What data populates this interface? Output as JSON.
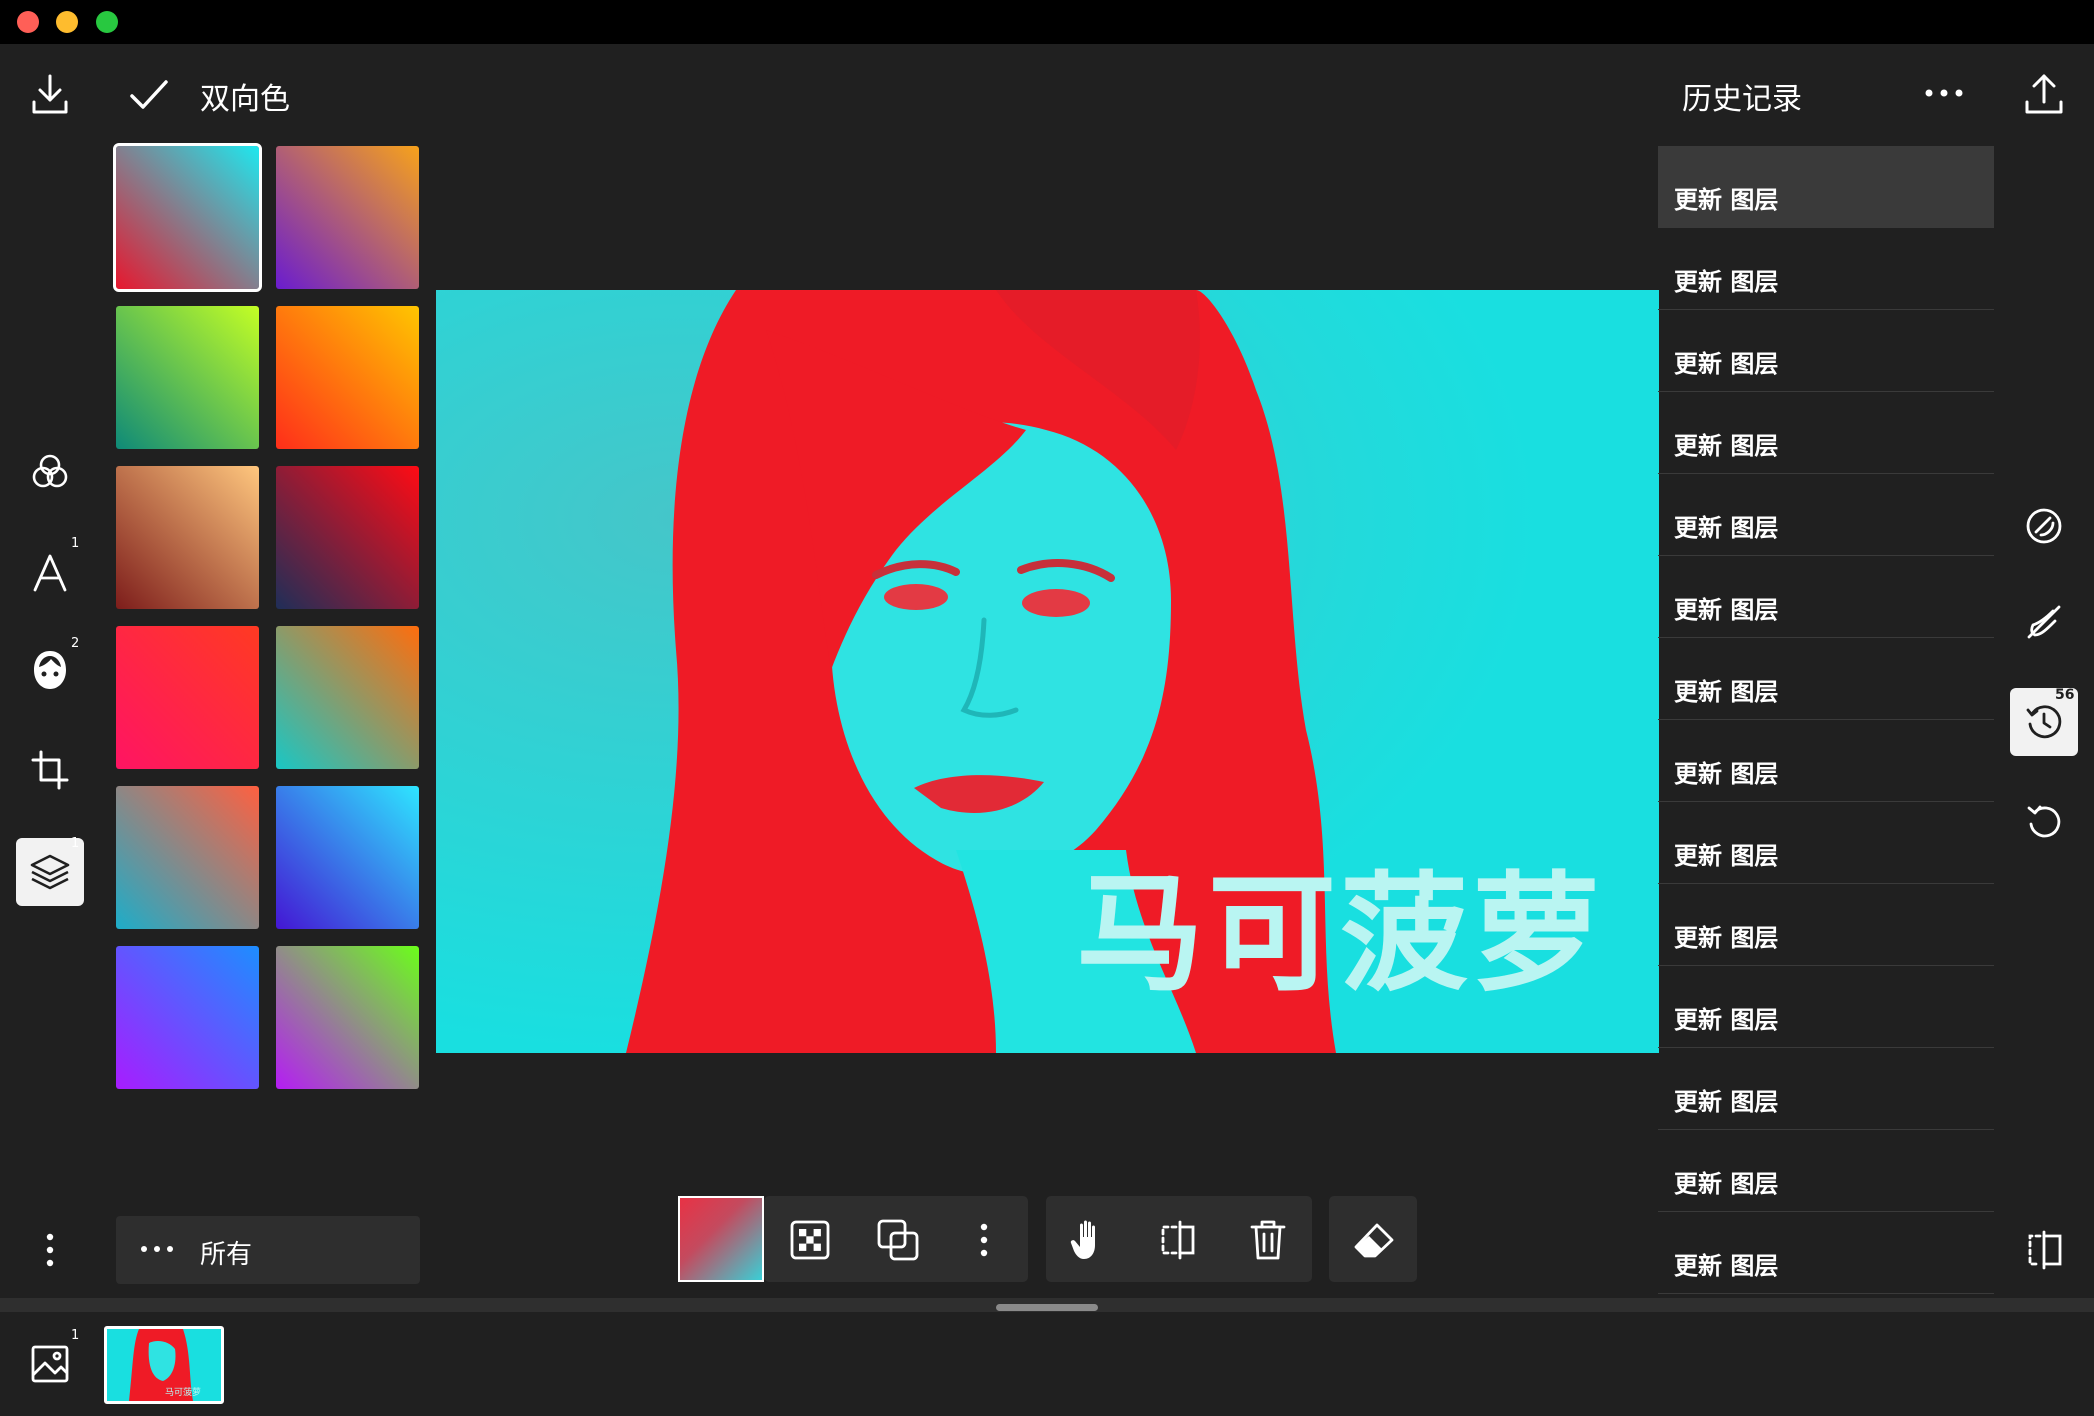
{
  "toolbar": {
    "tool_title": "双向色",
    "history_title": "历史记录"
  },
  "sidebar": {
    "badges": {
      "text": "1",
      "sticker": "2",
      "layers": "1",
      "images": "1"
    }
  },
  "presets": {
    "filter_label": "所有",
    "swatches": [
      {
        "name": "red-cyan",
        "from": "#e8172e",
        "to": "#1ee8ef",
        "selected": true
      },
      {
        "name": "purple-orange",
        "from": "#6a1ccf",
        "to": "#f7a21b"
      },
      {
        "name": "teal-lime",
        "from": "#0e8a78",
        "to": "#c4ff24"
      },
      {
        "name": "red-yellow",
        "from": "#ff2e1a",
        "to": "#ffc600"
      },
      {
        "name": "brown-peach",
        "from": "#7d1d1b",
        "to": "#ffc77e"
      },
      {
        "name": "navy-red",
        "from": "#1f2e58",
        "to": "#ff0b14"
      },
      {
        "name": "pink-red",
        "from": "#ff1463",
        "to": "#ff3a22"
      },
      {
        "name": "teal-orange",
        "from": "#19c7c5",
        "to": "#ff6d0d"
      },
      {
        "name": "blue-salmon",
        "from": "#1dadc9",
        "to": "#ff6040"
      },
      {
        "name": "indigo-sky",
        "from": "#4416d4",
        "to": "#2ee6ff"
      },
      {
        "name": "violet-blue",
        "from": "#a81cff",
        "to": "#1d8eff"
      },
      {
        "name": "magenta-green",
        "from": "#b51cf5",
        "to": "#6bff1a"
      }
    ]
  },
  "canvas": {
    "overlay_text": "马可菠萝",
    "duotone": {
      "dark": "#ef1b26",
      "light": "#19dfe0"
    }
  },
  "history": {
    "items": [
      "更新 图层",
      "更新 图层",
      "更新 图层",
      "更新 图层",
      "更新 图层",
      "更新 图层",
      "更新 图层",
      "更新 图层",
      "更新 图层",
      "更新 图层",
      "更新 图层",
      "更新 图层",
      "更新 图层",
      "更新 图层"
    ],
    "active_index": 0,
    "count_badge": "56"
  },
  "colors": {
    "background": "#202020",
    "panel": "#2e2e2e",
    "accent_white": "#ffffff"
  }
}
